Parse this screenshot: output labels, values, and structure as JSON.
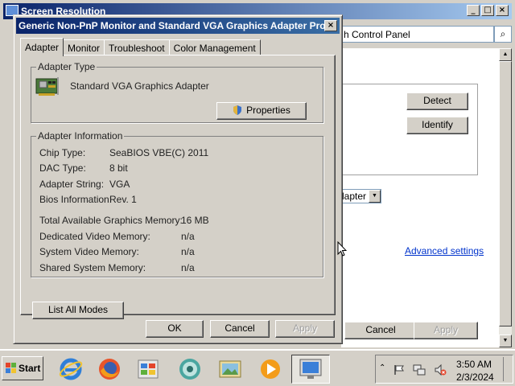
{
  "background_window": {
    "title": "Screen Resolution",
    "address_text": "h Control Panel",
    "buttons": {
      "detect": "Detect",
      "identify": "Identify",
      "cancel": "Cancel",
      "apply": "Apply"
    },
    "display_select": "lapter",
    "advanced_link": "Advanced settings"
  },
  "dialog": {
    "title": "Generic Non-PnP Monitor and Standard VGA Graphics Adapter Pro...",
    "tabs": [
      {
        "label": "Adapter",
        "active": true
      },
      {
        "label": "Monitor",
        "active": false
      },
      {
        "label": "Troubleshoot",
        "active": false
      },
      {
        "label": "Color Management",
        "active": false
      }
    ],
    "adapter_type": {
      "legend": "Adapter Type",
      "name": "Standard VGA Graphics Adapter",
      "properties_button": "Properties"
    },
    "adapter_info": {
      "legend": "Adapter Information",
      "rows": [
        {
          "label": "Chip Type:",
          "value": "SeaBIOS VBE(C) 2011"
        },
        {
          "label": "DAC Type:",
          "value": "8 bit"
        },
        {
          "label": "Adapter String:",
          "value": "VGA"
        },
        {
          "label": "Bios Information:",
          "value": "Rev. 1"
        }
      ],
      "memory_rows": [
        {
          "label": "Total Available Graphics Memory:",
          "value": "16 MB"
        },
        {
          "label": "Dedicated Video Memory:",
          "value": "n/a"
        },
        {
          "label": "System Video Memory:",
          "value": "n/a"
        },
        {
          "label": "Shared System Memory:",
          "value": "n/a"
        }
      ]
    },
    "list_all_modes_button": "List All Modes",
    "ok_button": "OK",
    "cancel_button": "Cancel",
    "apply_button": "Apply"
  },
  "taskbar": {
    "start_label": "Start",
    "apps": [
      "internet-explorer-icon",
      "firefox-icon",
      "control-panel-icon",
      "network-icon",
      "photo-viewer-icon",
      "media-player-icon",
      "display-settings-icon"
    ],
    "clock_time": "3:50 AM",
    "clock_date": "2/3/2024"
  },
  "colors": {
    "titlebar_active": "#0a246a",
    "face": "#d4d0c8",
    "link": "#0033cc"
  }
}
